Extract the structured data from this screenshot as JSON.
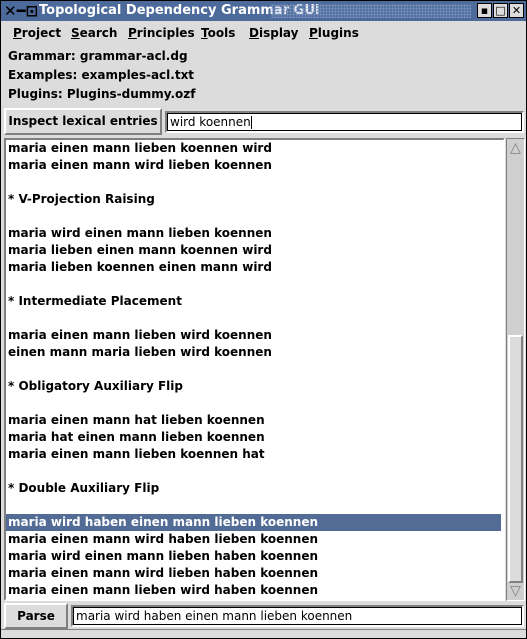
{
  "window": {
    "title": "Topological Dependency Grammar GUI",
    "app_icon": "x-pin-icon",
    "controls": [
      "minimize",
      "maximize",
      "close"
    ]
  },
  "menu": [
    {
      "label": "Project",
      "mnemonic": "P",
      "rest": "roject"
    },
    {
      "label": "Search",
      "mnemonic": "S",
      "rest": "earch"
    },
    {
      "label": "Principles",
      "mnemonic": "P",
      "rest": "rinciples"
    },
    {
      "label": "Tools",
      "mnemonic": "T",
      "rest": "ools"
    },
    {
      "label": "Display",
      "mnemonic": "D",
      "rest": "isplay"
    },
    {
      "label": "Plugins",
      "mnemonic": "P",
      "rest": "lugins"
    }
  ],
  "info": {
    "grammar": "Grammar: grammar-acl.dg",
    "examples": "Examples: examples-acl.txt",
    "plugins": "Plugins: Plugins-dummy.ozf"
  },
  "inspect": {
    "button_label": "Inspect lexical entries",
    "input_value": "wird koennen"
  },
  "examples_list": [
    {
      "text": "maria einen mann lieben koennen wird",
      "selected": false
    },
    {
      "text": "maria einen mann wird lieben koennen",
      "selected": false
    },
    {
      "text": "",
      "selected": false
    },
    {
      "text": "* V-Projection Raising",
      "selected": false
    },
    {
      "text": "",
      "selected": false
    },
    {
      "text": "maria wird einen mann lieben koennen",
      "selected": false
    },
    {
      "text": "maria lieben einen mann koennen wird",
      "selected": false
    },
    {
      "text": "maria lieben koennen einen mann wird",
      "selected": false
    },
    {
      "text": "",
      "selected": false
    },
    {
      "text": "* Intermediate Placement",
      "selected": false
    },
    {
      "text": "",
      "selected": false
    },
    {
      "text": "maria einen mann lieben wird koennen",
      "selected": false
    },
    {
      "text": "einen mann maria lieben wird koennen",
      "selected": false
    },
    {
      "text": "",
      "selected": false
    },
    {
      "text": "* Obligatory Auxiliary Flip",
      "selected": false
    },
    {
      "text": "",
      "selected": false
    },
    {
      "text": "maria einen mann hat lieben koennen",
      "selected": false
    },
    {
      "text": "maria hat einen mann lieben koennen",
      "selected": false
    },
    {
      "text": "maria einen mann lieben koennen hat",
      "selected": false
    },
    {
      "text": "",
      "selected": false
    },
    {
      "text": "* Double Auxiliary Flip",
      "selected": false
    },
    {
      "text": "",
      "selected": false
    },
    {
      "text": "maria wird haben einen mann lieben koennen",
      "selected": true
    },
    {
      "text": "maria einen mann wird haben lieben koennen",
      "selected": false
    },
    {
      "text": "maria wird einen mann lieben haben koennen",
      "selected": false
    },
    {
      "text": "maria einen mann wird lieben haben koennen",
      "selected": false
    },
    {
      "text": "maria einen mann lieben wird haben koennen",
      "selected": false
    }
  ],
  "scroll": {
    "position_fraction": 0.42,
    "visible_fraction": 0.58
  },
  "parse": {
    "button_label": "Parse",
    "input_value": "maria wird haben einen mann lieben koennen"
  },
  "colors": {
    "titlebar": "#4c6a9a",
    "selection": "#536c95",
    "background": "#dcdcdc"
  }
}
